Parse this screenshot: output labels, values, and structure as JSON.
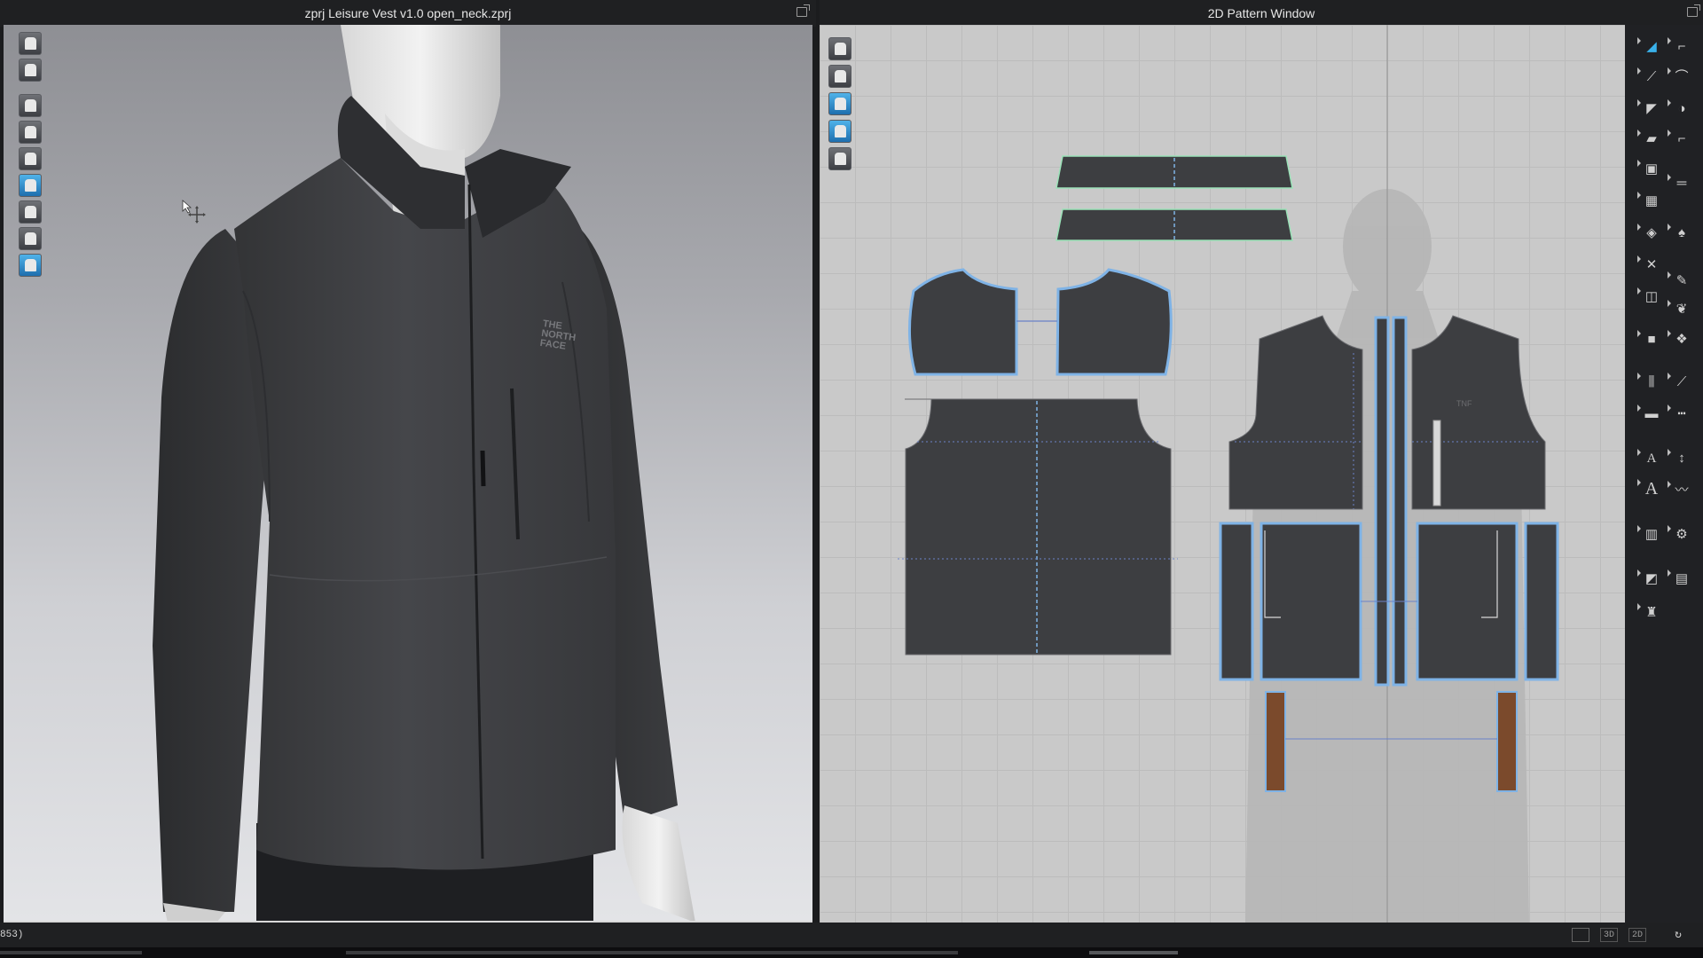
{
  "window": {
    "viewer_title": "zprj Leisure Vest v1.0 open_neck.zprj",
    "pattern_title": "2D Pattern Window"
  },
  "viewer_tools": [
    "avatar-icon",
    "garment-icon",
    "simulation-icon",
    "select-mesh-icon",
    "avatar-display-icon",
    "texture-surface-icon",
    "pin-icon",
    "mannequin-icon",
    "globe-icon"
  ],
  "pattern_tools": [
    "transform-pattern-icon",
    "garment-view-icon",
    "info-icon",
    "texture-edit-icon",
    "lock-icon"
  ],
  "garment": {
    "logo_text": "THE NORTH FACE"
  },
  "pattern_panel": {
    "tools": [
      "select-icon",
      "edit-point-icon",
      "polygon-icon",
      "rectangle-icon",
      "circle-icon",
      "internal-shape-icon",
      "dart-icon",
      "trace-icon",
      "fold-icon",
      "segment-sewing-icon",
      "free-sewing-icon",
      "tape-icon",
      "text-annotation-icon",
      "grading-icon",
      "pleat-icon",
      "measure-icon",
      "ruler-icon",
      "stitch-icon",
      "zipper-icon",
      "button-icon",
      "topstitch-icon"
    ],
    "text_labels": [
      "A",
      "A"
    ]
  },
  "status": {
    "left_text": "853)"
  },
  "view_buttons": [
    "3D",
    "2D"
  ],
  "colors": {
    "fabric": "#3d3e41",
    "seam_highlight": "#7fb3e6",
    "grainline": "#6a82c8",
    "trim": "#7b4a2c",
    "selected_outline": "#9be2b8"
  }
}
